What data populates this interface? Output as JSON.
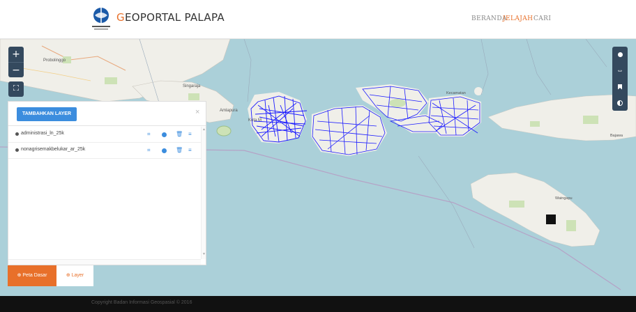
{
  "header": {
    "brand_first": "G",
    "brand_rest": "EOPORTAL PALAPA",
    "nav": [
      {
        "label": "BERANDA",
        "active": false
      },
      {
        "label": "JELAJAH",
        "active": true
      },
      {
        "label": "CARI",
        "active": false
      }
    ]
  },
  "map_controls": {
    "zoom_in": "+",
    "zoom_out": "−"
  },
  "right_controls": [
    "info-icon",
    "swap-icon",
    "bookmark-icon",
    "contrast-icon"
  ],
  "map_labels": {
    "probolinggo": "Probolinggo",
    "singaraja": "Singaraja",
    "amlapura": "Amlapura",
    "kota": "Kota M",
    "waingapu": "Waingapu",
    "bajawa": "Bajawa",
    "mataram_area": "Kecamatan"
  },
  "panel": {
    "add_button": "TAMBAHKAN LAYER",
    "close": "×",
    "layers": [
      {
        "name": "administrasi_ln_25k"
      },
      {
        "name": "nonagrisemakbelukar_ar_25k"
      }
    ]
  },
  "tabs": {
    "base_map": "⊕ Peta Dasar",
    "layer": "⊕ Layer"
  },
  "footer": {
    "copyright": "Copyright Badan Informasi Geospasial © 2016"
  },
  "colors": {
    "accent": "#e8702a",
    "button": "#3c8dde",
    "control": "#34495e",
    "sea": "#abd0d9",
    "land": "#f0efe9",
    "overlay_lines": "#1a1aff"
  }
}
